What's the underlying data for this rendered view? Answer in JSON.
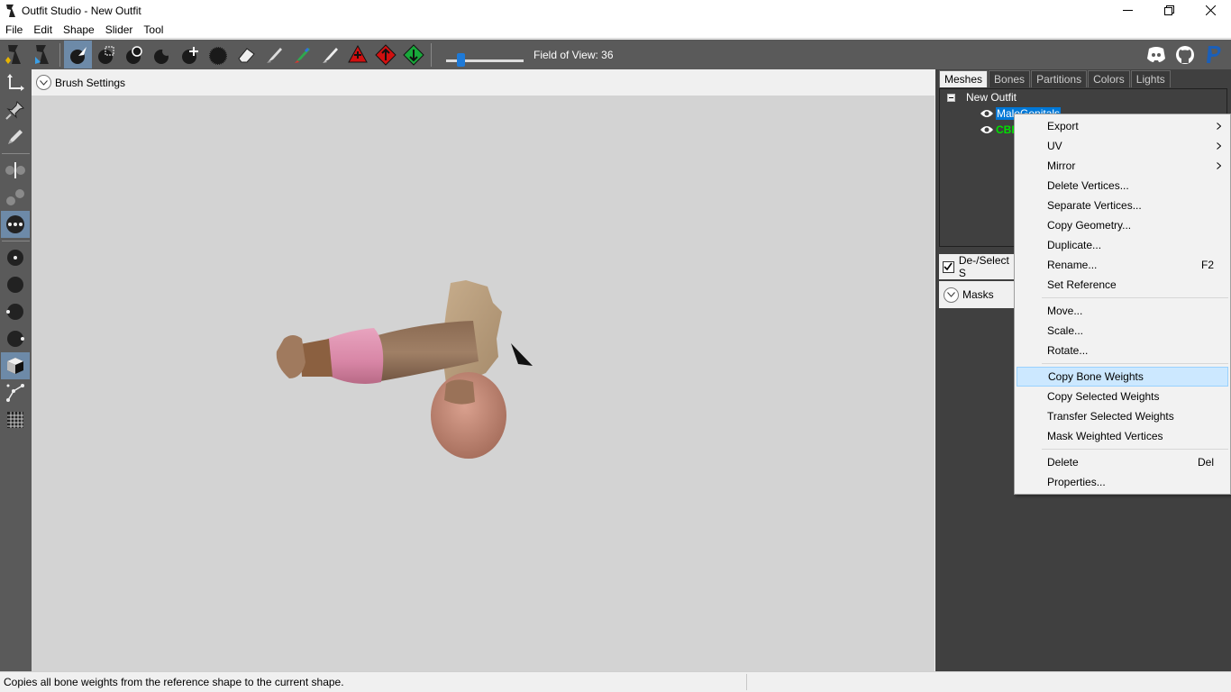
{
  "window": {
    "title": "Outfit Studio - New Outfit"
  },
  "menubar": {
    "items": [
      "File",
      "Edit",
      "Shape",
      "Slider",
      "Tool"
    ]
  },
  "toolbar": {
    "fov_label": "Field of View: 36",
    "fov_value": 36,
    "icons": [
      "outfitstudio-logo-icon",
      "bodyslide-logo-icon",
      "select-brush-icon",
      "mask-brush-icon",
      "inflate-brush-icon",
      "deflate-brush-icon",
      "move-brush-icon",
      "smooth-brush-icon",
      "undiff-brush-icon",
      "weight-brush-icon",
      "color-brush-icon",
      "alpha-brush-icon",
      "transform-red-icon",
      "transform-green-icon"
    ]
  },
  "viewport": {
    "brush_settings_label": "Brush Settings"
  },
  "right_panel": {
    "tabs": [
      "Meshes",
      "Bones",
      "Partitions",
      "Colors",
      "Lights"
    ],
    "active_tab": "Meshes",
    "tree": {
      "root": "New Outfit",
      "items": [
        {
          "label": "MaleGenitals",
          "selected": true
        },
        {
          "label": "CBB",
          "green": true
        }
      ]
    },
    "deselect_label": "De-/Select S",
    "masks_label": "Masks"
  },
  "context_menu": {
    "items": [
      {
        "label": "Export",
        "submenu": true
      },
      {
        "label": "UV",
        "submenu": true
      },
      {
        "label": "Mirror",
        "submenu": true
      },
      {
        "label": "Delete Vertices..."
      },
      {
        "label": "Separate Vertices..."
      },
      {
        "label": "Copy Geometry..."
      },
      {
        "label": "Duplicate..."
      },
      {
        "label": "Rename...",
        "shortcut": "F2"
      },
      {
        "label": "Set Reference"
      },
      {
        "separator": true
      },
      {
        "label": "Move..."
      },
      {
        "label": "Scale..."
      },
      {
        "label": "Rotate..."
      },
      {
        "separator": true
      },
      {
        "label": "Copy Bone Weights",
        "highlight": true
      },
      {
        "label": "Copy Selected Weights"
      },
      {
        "label": "Transfer Selected Weights"
      },
      {
        "label": "Mask Weighted Vertices"
      },
      {
        "separator": true
      },
      {
        "label": "Delete",
        "shortcut": "Del"
      },
      {
        "label": "Properties..."
      }
    ]
  },
  "statusbar": {
    "text": "Copies all bone weights from the reference shape to the current shape."
  },
  "colors": {
    "accent": "#0078d7",
    "toolbar_bg": "#5a5a5a",
    "panel_bg": "#404040",
    "viewport_bg": "#d3d3d3",
    "highlight": "#cce8ff"
  }
}
